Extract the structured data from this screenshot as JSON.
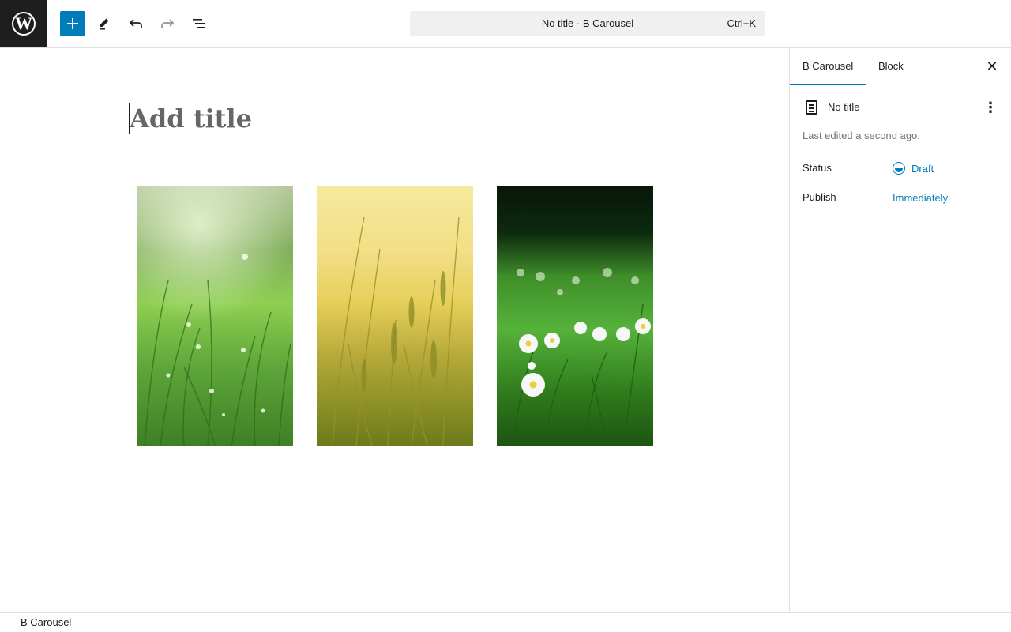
{
  "header": {
    "logo": "wordpress-logo",
    "add_block_icon": "plus-icon",
    "tools_icon": "pencil-icon",
    "undo_icon": "undo-icon",
    "redo_icon": "redo-icon",
    "document_overview_icon": "list-view-icon",
    "document_title": "No title · B Carousel",
    "shortcut": "Ctrl+K"
  },
  "editor": {
    "title_placeholder": "Add title",
    "carousel": {
      "slides": [
        {
          "description": "dewy green grass"
        },
        {
          "description": "golden wheat field"
        },
        {
          "description": "white daisies in grass"
        }
      ]
    }
  },
  "sidebar": {
    "tabs": [
      {
        "label": "B Carousel",
        "active": true
      },
      {
        "label": "Block",
        "active": false
      }
    ],
    "close_icon": "close-icon",
    "post": {
      "icon": "page-icon",
      "title": "No title",
      "more_icon": "more-vertical-icon"
    },
    "last_edited": "Last edited a second ago.",
    "status": {
      "label": "Status",
      "value": "Draft"
    },
    "publish": {
      "label": "Publish",
      "value": "Immediately"
    }
  },
  "footer": {
    "breadcrumb": "B Carousel"
  },
  "colors": {
    "accent": "#007cba",
    "header_logo_bg": "#1e1e1e",
    "muted_text": "#757575"
  }
}
